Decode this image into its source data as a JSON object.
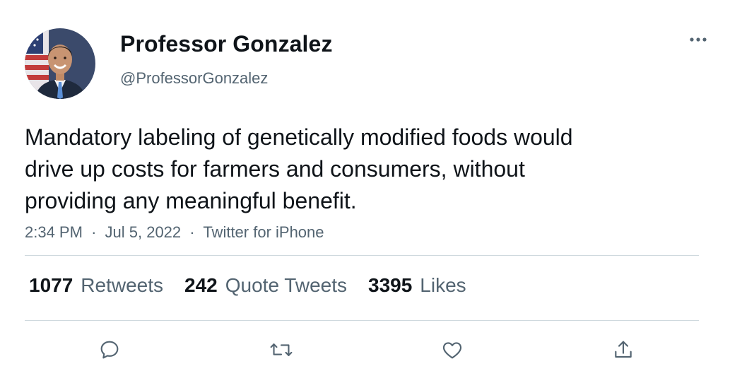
{
  "author": {
    "display_name": "Professor Gonzalez",
    "handle": "@ProfessorGonzalez",
    "avatar_icon": "profile-photo"
  },
  "tweet": {
    "text": "Mandatory labeling of genetically modified foods would\ndrive up costs for farmers and consumers, without\nproviding any meaningful benefit.",
    "time": "2:34 PM",
    "date": "Jul 5, 2022",
    "source": "Twitter for iPhone",
    "separator": "·"
  },
  "stats": {
    "retweets_count": "1077",
    "retweets_label": "Retweets",
    "quote_tweets_count": "242",
    "quote_tweets_label": "Quote Tweets",
    "likes_count": "3395",
    "likes_label": "Likes"
  },
  "actions": {
    "reply_icon": "comment-bubble-icon",
    "retweet_icon": "retweet-arrows-icon",
    "like_icon": "heart-icon",
    "share_icon": "share-upload-icon",
    "more_icon": "three-dots-icon"
  },
  "colors": {
    "text_primary": "#0f1419",
    "text_secondary": "#536471",
    "divider": "#cfd9de"
  }
}
